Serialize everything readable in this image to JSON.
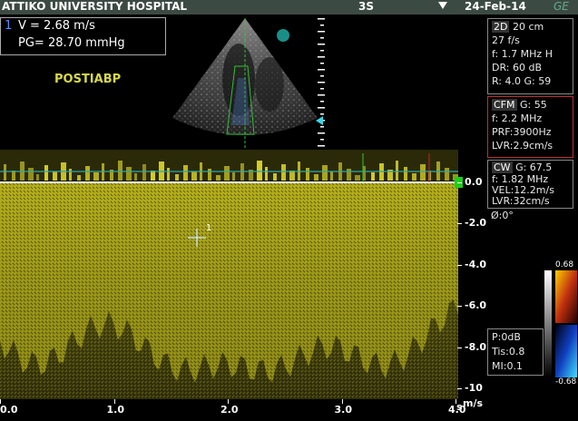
{
  "header": {
    "hospital": "ATTIKO UNIVERSITY HOSPITAL",
    "probe": "3S",
    "date": "24-Feb-14"
  },
  "measurement": {
    "index": "1",
    "velocity": "V  = 2.68 m/s",
    "gradient": "PG= 28.70 mmHg"
  },
  "label": "POSTIABP",
  "panel_2d": {
    "tag": "2D",
    "depth": "20 cm",
    "frame_rate": "27 f/s",
    "frequency": "f: 1.7 MHz H",
    "dynamic_range": "DR: 60 dB",
    "r_g": "R: 4.0   G: 59"
  },
  "panel_cfm": {
    "tag": "CFM",
    "gain": "G: 55",
    "frequency": "f: 2.2 MHz",
    "prf": "PRF:3900Hz",
    "lvr": "LVR:2.9cm/s"
  },
  "panel_cw": {
    "tag": "CW",
    "gain": "G: 67.5",
    "frequency": "f: 1.82 MHz",
    "vel": "VEL:12.2m/s",
    "lvr": "LVR:32cm/s",
    "angle": "Ø:0°"
  },
  "panel_misc": {
    "power": "P:0dB",
    "tis": "Tis:0.8",
    "mi": "MI:0.1"
  },
  "doppler": {
    "y_ticks": [
      "0.0",
      "-2.0",
      "-4.0",
      "-6.0",
      "-8.0",
      "-10"
    ],
    "y_values": [
      0,
      -2,
      -4,
      -6,
      -8,
      -10
    ],
    "y_unit": "m/s",
    "x_ticks": [
      "0.0",
      "1.0",
      "2.0",
      "3.0",
      "4.0"
    ],
    "x_values": [
      0,
      1,
      2,
      3,
      4
    ],
    "x_unit": "s",
    "cursor_index": "1"
  },
  "colorbar": {
    "max": "0.68",
    "min": "-0.68"
  },
  "colors": {
    "spectrum": "#c9c21e",
    "baseline": "#ffffff",
    "panel_cfm_border": "#b33333",
    "header_bg": "#3c4a44"
  }
}
